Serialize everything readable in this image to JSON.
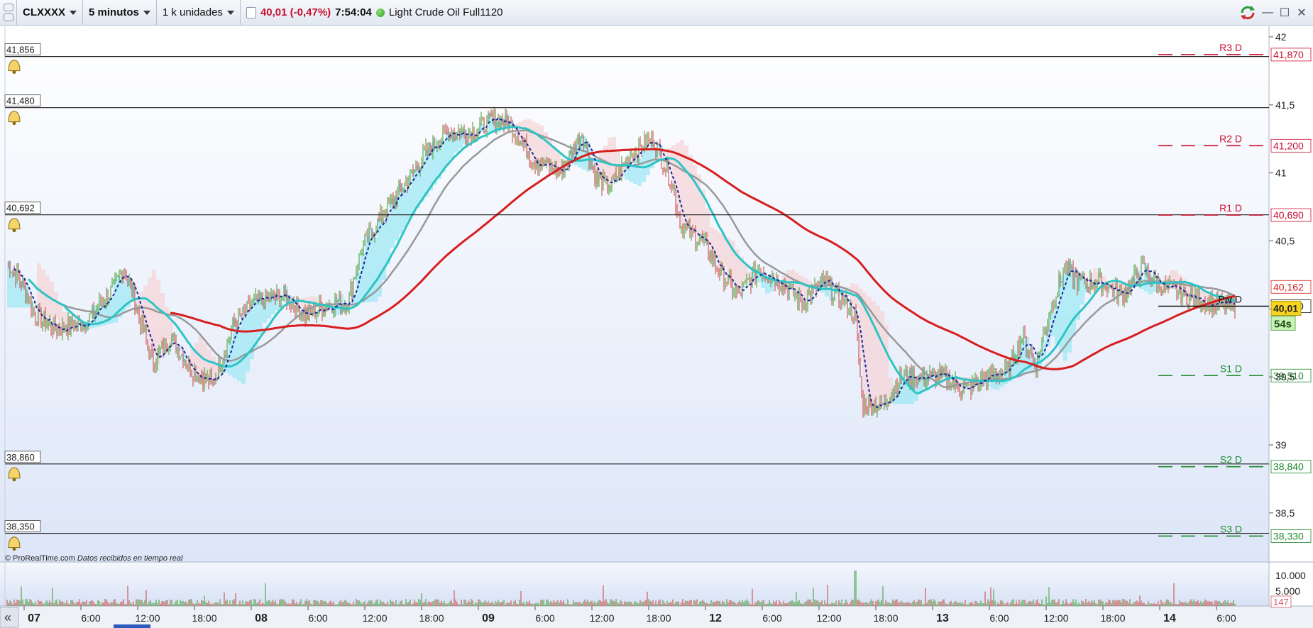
{
  "toolbar": {
    "symbol": "CLXXXX",
    "timeframe": "5 minutos",
    "units": "1 k unidades",
    "last_price": "40,01 (-0,47%)",
    "clock": "7:54:04",
    "instrument_name": "Light Crude Oil Full1120"
  },
  "price_axis": {
    "ticks": [
      "42",
      "41,5",
      "41",
      "40,5",
      "40",
      "39,5",
      "39",
      "38,5"
    ]
  },
  "pivots": [
    {
      "label": "R3 D",
      "value": "41,870",
      "color": "#c8102e"
    },
    {
      "label": "R2 D",
      "value": "41,200",
      "color": "#c8102e"
    },
    {
      "label": "R1 D",
      "value": "40,690",
      "color": "#c8102e"
    },
    {
      "label": "Piv D",
      "value": "40,020",
      "color": "#111111"
    },
    {
      "label": "S1 D",
      "value": "39,510",
      "color": "#1f8a2c"
    },
    {
      "label": "S2 D",
      "value": "38,840",
      "color": "#1f8a2c"
    },
    {
      "label": "S3 D",
      "value": "38,330",
      "color": "#1f8a2c"
    }
  ],
  "alert_lines": [
    "41,856",
    "41,480",
    "40,692",
    "38,860",
    "38,350"
  ],
  "current_price_tag": "40,01",
  "countdown": "54s",
  "ma_value_tag": "40,162",
  "source_note": "© ProRealTime.com",
  "source_note_italic": "Datos recibidos en tiempo real",
  "volume_panel": {
    "ticks": [
      "10.000",
      "5.000"
    ],
    "current_volume": "147"
  },
  "time_axis": {
    "labels": [
      "07",
      "6:00",
      "12:00",
      "18:00",
      "08",
      "6:00",
      "12:00",
      "18:00",
      "09",
      "6:00",
      "12:00",
      "18:00",
      "12",
      "6:00",
      "12:00",
      "18:00",
      "13",
      "6:00",
      "12:00",
      "18:00",
      "14",
      "6:00"
    ],
    "bold": [
      true,
      false,
      false,
      false,
      true,
      false,
      false,
      false,
      true,
      false,
      false,
      false,
      true,
      false,
      false,
      false,
      true,
      false,
      false,
      false,
      true,
      false
    ],
    "collapse_button": "«"
  },
  "colors": {
    "ma_long": "#d81e1e",
    "ma_mid": "#999999",
    "ma_fast": "#2ec4c4",
    "ma_dashed": "#1b2a9c",
    "cloud_bull": "#9fe8f4",
    "cloud_bear": "#f6d5d8",
    "candle_up": "#3a9a2a",
    "candle_down": "#c8403a"
  }
}
